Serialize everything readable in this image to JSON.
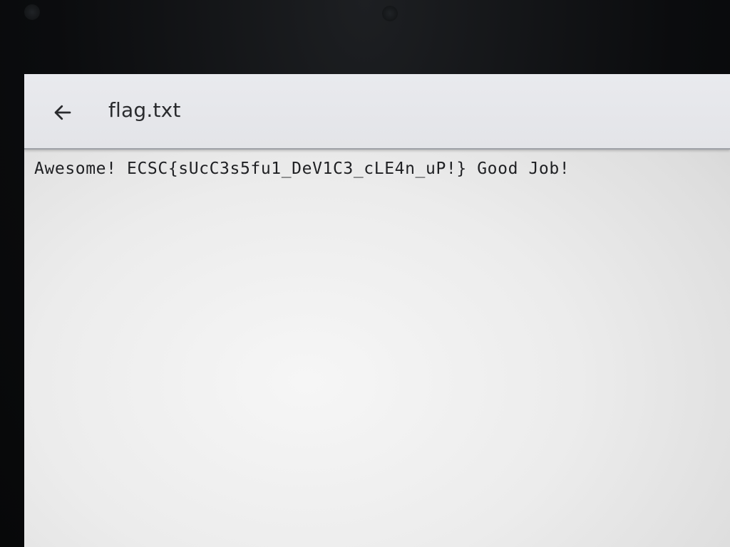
{
  "app_bar": {
    "title": "flag.txt",
    "back_icon": "arrow-left-icon"
  },
  "document": {
    "text": "Awesome! ECSC{sUcC3s5fu1_DeV1C3_cLE4n_uP!} Good Job!"
  }
}
